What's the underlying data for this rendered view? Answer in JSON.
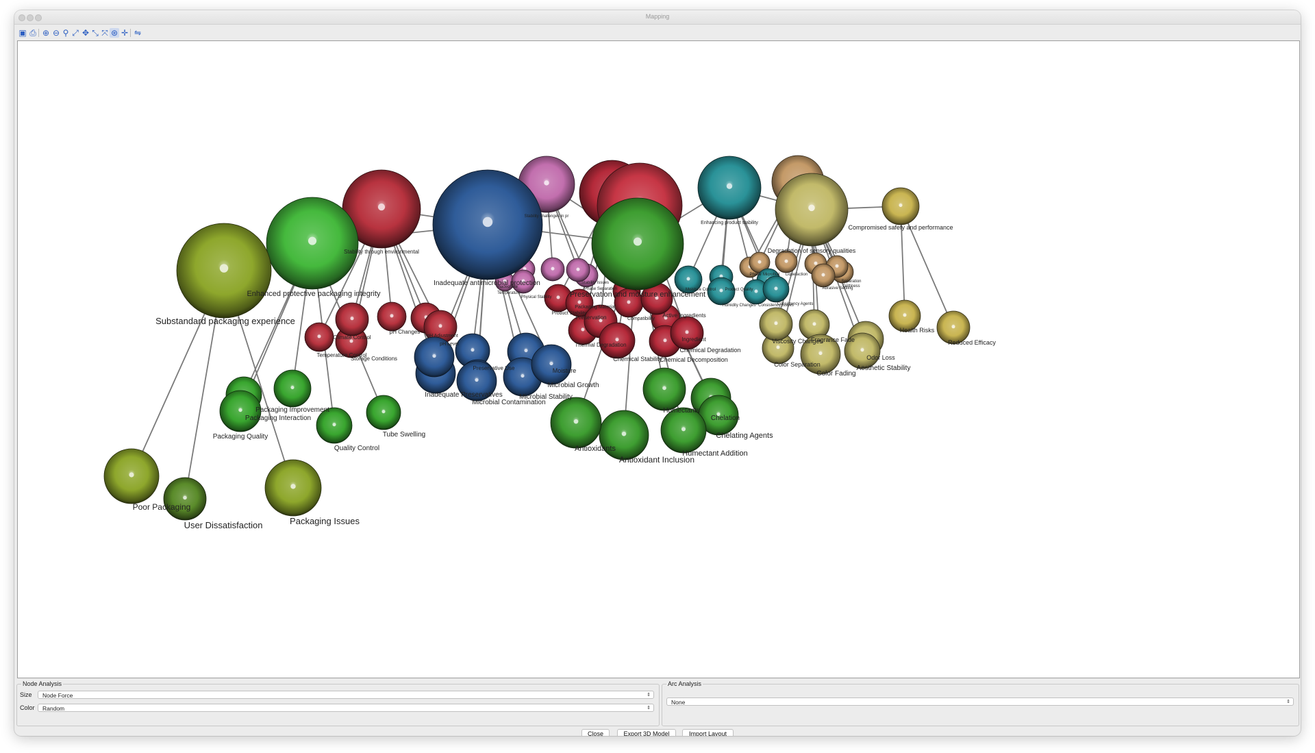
{
  "window": {
    "title": "Mapping"
  },
  "toolbar": {
    "buttons": [
      {
        "icon": "save-icon",
        "glyph": "▣",
        "active": false
      },
      {
        "icon": "print-icon",
        "glyph": "⎙",
        "active": false
      },
      {
        "icon": "zoom-in-icon",
        "glyph": "⊕",
        "active": false
      },
      {
        "icon": "zoom-out-icon",
        "glyph": "⊖",
        "active": false
      },
      {
        "icon": "zoom-search-icon",
        "glyph": "⚲",
        "active": false
      },
      {
        "icon": "fit-window-icon",
        "glyph": "⤢",
        "active": false
      },
      {
        "icon": "move-icon",
        "glyph": "✥",
        "active": false
      },
      {
        "icon": "expand-icon",
        "glyph": "⤡",
        "active": false
      },
      {
        "icon": "contract-icon",
        "glyph": "⤧",
        "active": false
      },
      {
        "icon": "rotate-icon",
        "glyph": "⊛",
        "active": true
      },
      {
        "icon": "pan-icon",
        "glyph": "✛",
        "active": false
      },
      {
        "icon": "layout-icon",
        "glyph": "⇋",
        "active": false
      }
    ]
  },
  "graph": {
    "nodes": [
      {
        "id": "n1",
        "label": "Substandard packaging experience",
        "color": "#8ea72c",
        "r": 69,
        "lx": "right",
        "fs": 13
      },
      {
        "id": "n2",
        "label": "Enhanced protective packaging integrity",
        "color": "#45b93d",
        "r": 67,
        "lx": "right",
        "fs": 11
      },
      {
        "id": "n3",
        "label": "Stability through environmental",
        "color": "#b8333f",
        "r": 57,
        "lx": "center",
        "fs": 8
      },
      {
        "id": "n4",
        "label": "Inadequate antimicrobial protection",
        "color": "#2f5c99",
        "r": 80,
        "lx": "center",
        "fs": 10
      },
      {
        "id": "n5",
        "label": "Stability challenges in pr",
        "color": "#c26fae",
        "r": 41,
        "lx": "center",
        "fs": 6
      },
      {
        "id": "n6",
        "label": "",
        "color": "#b52a3a",
        "r": 48,
        "lx": "center",
        "fs": 8
      },
      {
        "id": "n7",
        "label": "",
        "color": "#c63645",
        "r": 62,
        "lx": "center",
        "fs": 8
      },
      {
        "id": "n8",
        "label": "Preservation and moisture enhancement",
        "color": "#3e9e31",
        "r": 67,
        "lx": "center",
        "fs": 11
      },
      {
        "id": "n9",
        "label": "Enhancing product stability",
        "color": "#2a9298",
        "r": 46,
        "lx": "center",
        "fs": 7
      },
      {
        "id": "n10",
        "label": "",
        "color": "#c49a68",
        "r": 38,
        "lx": "center",
        "fs": 8
      },
      {
        "id": "n11",
        "label": "Degradation of sensory qualities",
        "color": "#c2ba6a",
        "r": 53,
        "lx": "right",
        "fs": 9
      },
      {
        "id": "n12",
        "label": "Compromised safety and performance",
        "color": "#c9b552",
        "r": 27,
        "lx": "right",
        "fs": 9
      },
      {
        "id": "p1",
        "label": "Packaging Interaction",
        "color": "#39a62f",
        "r": 26,
        "lx": "center",
        "fs": 10
      },
      {
        "id": "p2",
        "label": "Packaging Quality",
        "color": "#39a62f",
        "r": 30,
        "lx": "center",
        "fs": 10
      },
      {
        "id": "p3",
        "label": "Packaging Improvement",
        "color": "#39a62f",
        "r": 27,
        "lx": "center",
        "fs": 10
      },
      {
        "id": "p4",
        "label": "Quality Control",
        "color": "#39a62f",
        "r": 26,
        "lx": "center",
        "fs": 10
      },
      {
        "id": "p5",
        "label": "Tube Swelling",
        "color": "#39a62f",
        "r": 25,
        "lx": "center",
        "fs": 10
      },
      {
        "id": "q1",
        "label": "Poor Packaging",
        "color": "#8ea72c",
        "r": 40,
        "lx": "center",
        "fs": 12
      },
      {
        "id": "q2",
        "label": "User Dissatisfaction",
        "color": "#5a8b2a",
        "r": 31,
        "lx": "center",
        "fs": 13
      },
      {
        "id": "q3",
        "label": "Packaging Issues",
        "color": "#8ea72c",
        "r": 41,
        "lx": "center",
        "fs": 13
      },
      {
        "id": "r1",
        "label": "Temperature Control",
        "color": "#b8333f",
        "r": 21,
        "lx": "center",
        "fs": 8
      },
      {
        "id": "r2",
        "label": "Climate Control",
        "color": "#b8333f",
        "r": 24,
        "lx": "center",
        "fs": 8
      },
      {
        "id": "r3",
        "label": "Storage Conditions",
        "color": "#b8333f",
        "r": 23,
        "lx": "center",
        "fs": 8
      },
      {
        "id": "r4",
        "label": "pH Changes",
        "color": "#b8333f",
        "r": 21,
        "lx": "center",
        "fs": 8
      },
      {
        "id": "r5",
        "label": "",
        "color": "#b8333f",
        "r": 22,
        "lx": "center",
        "fs": 8
      },
      {
        "id": "r6",
        "label": "pH Adjustment",
        "color": "#b8333f",
        "r": 24,
        "lx": "center",
        "fs": 7
      },
      {
        "id": "r7",
        "label": "pH Level",
        "color": "#b8333f",
        "r": 23,
        "lx": "center",
        "fs": 7
      },
      {
        "id": "b1",
        "label": "Preservative Use",
        "color": "#2f5c99",
        "r": 25,
        "lx": "center",
        "fs": 8
      },
      {
        "id": "b2",
        "label": "Inadequate Preservatives",
        "color": "#2f5c99",
        "r": 29,
        "lx": "center",
        "fs": 10
      },
      {
        "id": "b3",
        "label": "Microbial Contamination",
        "color": "#2f5c99",
        "r": 29,
        "lx": "center",
        "fs": 10
      },
      {
        "id": "b4",
        "label": "Moisture",
        "color": "#2f5c99",
        "r": 27,
        "lx": "center",
        "fs": 9
      },
      {
        "id": "b5",
        "label": "Microbial Growth",
        "color": "#2f5c99",
        "r": 29,
        "lx": "center",
        "fs": 10
      },
      {
        "id": "b6",
        "label": "Microbial Stability",
        "color": "#2f5c99",
        "r": 28,
        "lx": "center",
        "fs": 10
      },
      {
        "id": "b7",
        "label": "",
        "color": "#2f5c99",
        "r": 25,
        "lx": "center",
        "fs": 8
      },
      {
        "id": "b8",
        "label": "",
        "color": "#2f5c99",
        "r": 29,
        "lx": "center",
        "fs": 8
      },
      {
        "id": "pk1",
        "label": "Physical Stability",
        "color": "#c26fae",
        "r": 17,
        "lx": "center",
        "fs": 6
      },
      {
        "id": "pk2",
        "label": "Temperature",
        "color": "#c26fae",
        "r": 17,
        "lx": "center",
        "fs": 6
      },
      {
        "id": "pk3",
        "label": "Phase Separation",
        "color": "#c26fae",
        "r": 17,
        "lx": "center",
        "fs": 6
      },
      {
        "id": "pk4",
        "label": "Stability Issues",
        "color": "#c26fae",
        "r": 17,
        "lx": "center",
        "fs": 6
      },
      {
        "id": "pk5",
        "label": "",
        "color": "#c26fae",
        "r": 15,
        "lx": "center",
        "fs": 6
      },
      {
        "id": "pk6",
        "label": "Inadequate",
        "color": "#c26fae",
        "r": 14,
        "lx": "center",
        "fs": 6
      },
      {
        "id": "rd1",
        "label": "Product Stability",
        "color": "#b52a3a",
        "r": 20,
        "lx": "center",
        "fs": 7
      },
      {
        "id": "rd2",
        "label": "Packaging Material",
        "color": "#b52a3a",
        "r": 20,
        "lx": "center",
        "fs": 7
      },
      {
        "id": "rd3",
        "label": "Preservation",
        "color": "#b52a3a",
        "r": 24,
        "lx": "center",
        "fs": 8
      },
      {
        "id": "rd4",
        "label": "Thermal Degradation",
        "color": "#b52a3a",
        "r": 21,
        "lx": "center",
        "fs": 8
      },
      {
        "id": "rd5",
        "label": "Chemical Stability",
        "color": "#b52a3a",
        "r": 26,
        "lx": "center",
        "fs": 9
      },
      {
        "id": "rd6",
        "label": "Compatibility",
        "color": "#b52a3a",
        "r": 21,
        "lx": "center",
        "fs": 7
      },
      {
        "id": "rd7",
        "label": "Active Ingredients",
        "color": "#b52a3a",
        "r": 23,
        "lx": "center",
        "fs": 8
      },
      {
        "id": "rd8",
        "label": "Chemical Degradation",
        "color": "#b52a3a",
        "r": 23,
        "lx": "center",
        "fs": 9
      },
      {
        "id": "rd9",
        "label": "Chemical Decomposition",
        "color": "#b52a3a",
        "r": 24,
        "lx": "center",
        "fs": 9
      },
      {
        "id": "rd10",
        "label": "Ingredient",
        "color": "#b52a3a",
        "r": 21,
        "lx": "center",
        "fs": 8
      },
      {
        "id": "rd11",
        "label": "",
        "color": "#b52a3a",
        "r": 20,
        "lx": "center",
        "fs": 8
      },
      {
        "id": "g1",
        "label": "Antioxidants",
        "color": "#3e9e31",
        "r": 37,
        "lx": "center",
        "fs": 11
      },
      {
        "id": "g2",
        "label": "Antioxidant Inclusion",
        "color": "#3e9e31",
        "r": 36,
        "lx": "center",
        "fs": 12
      },
      {
        "id": "g3",
        "label": "Humectants",
        "color": "#3e9e31",
        "r": 31,
        "lx": "center",
        "fs": 10
      },
      {
        "id": "g4",
        "label": "Humectant Addition",
        "color": "#3e9e31",
        "r": 33,
        "lx": "center",
        "fs": 11
      },
      {
        "id": "g5",
        "label": "Chelation",
        "color": "#3e9e31",
        "r": 29,
        "lx": "center",
        "fs": 10
      },
      {
        "id": "g6",
        "label": "Chelating Agents",
        "color": "#3e9e31",
        "r": 29,
        "lx": "center",
        "fs": 11
      },
      {
        "id": "t1",
        "label": "Moisture Control",
        "color": "#2a9298",
        "r": 20,
        "lx": "center",
        "fs": 6
      },
      {
        "id": "t2",
        "label": "Product Quality",
        "color": "#2a9298",
        "r": 17,
        "lx": "center",
        "fs": 6
      },
      {
        "id": "t3",
        "label": "Humidity Changes",
        "color": "#2a9298",
        "r": 20,
        "lx": "center",
        "fs": 6
      },
      {
        "id": "t4",
        "label": "Consistency Issues",
        "color": "#2a9298",
        "r": 18,
        "lx": "center",
        "fs": 6
      },
      {
        "id": "t5",
        "label": "",
        "color": "#2a9298",
        "r": 17,
        "lx": "center",
        "fs": 6
      },
      {
        "id": "t6",
        "label": "",
        "color": "#2a9298",
        "r": 19,
        "lx": "center",
        "fs": 6
      },
      {
        "id": "k1",
        "label": "Phase",
        "color": "#c49a68",
        "r": 15,
        "lx": "center",
        "fs": 6
      },
      {
        "id": "k2",
        "label": "Microbial",
        "color": "#c49a68",
        "r": 15,
        "lx": "center",
        "fs": 6
      },
      {
        "id": "k3",
        "label": "Liquefaction",
        "color": "#c49a68",
        "r": 16,
        "lx": "center",
        "fs": 6
      },
      {
        "id": "k4",
        "label": "Consistency Agents",
        "color": "#c49a68",
        "r": 16,
        "lx": "center",
        "fs": 6
      },
      {
        "id": "k5",
        "label": "Abrasive Settling",
        "color": "#c49a68",
        "r": 17,
        "lx": "center",
        "fs": 6
      },
      {
        "id": "k6",
        "label": "Grittiness",
        "color": "#c49a68",
        "r": 16,
        "lx": "center",
        "fs": 6
      },
      {
        "id": "k7",
        "label": "Separation",
        "color": "#c49a68",
        "r": 16,
        "lx": "center",
        "fs": 6
      },
      {
        "id": "y1",
        "label": "Viscosity Changes",
        "color": "#c2ba6a",
        "r": 24,
        "lx": "center",
        "fs": 9
      },
      {
        "id": "y2",
        "label": "Fragrance Fade",
        "color": "#c2ba6a",
        "r": 22,
        "lx": "center",
        "fs": 9
      },
      {
        "id": "y3",
        "label": "Color Separation",
        "color": "#c2ba6a",
        "r": 23,
        "lx": "center",
        "fs": 9
      },
      {
        "id": "y4",
        "label": "Color Fading",
        "color": "#c2ba6a",
        "r": 29,
        "lx": "center",
        "fs": 10
      },
      {
        "id": "y5",
        "label": "Odor Loss",
        "color": "#c2ba6a",
        "r": 26,
        "lx": "center",
        "fs": 9
      },
      {
        "id": "y6",
        "label": "Aesthetic Stability",
        "color": "#c2ba6a",
        "r": 26,
        "lx": "center",
        "fs": 10
      },
      {
        "id": "s1",
        "label": "Health Risks",
        "color": "#c9b552",
        "r": 23,
        "lx": "center",
        "fs": 9
      },
      {
        "id": "s2",
        "label": "Reduced Efficacy",
        "color": "#c9b552",
        "r": 24,
        "lx": "center",
        "fs": 9
      }
    ],
    "edges": [
      [
        "n1",
        "n2"
      ],
      [
        "n2",
        "n3"
      ],
      [
        "n2",
        "n4"
      ],
      [
        "n3",
        "n4"
      ],
      [
        "n4",
        "n5"
      ],
      [
        "n4",
        "n8"
      ],
      [
        "n5",
        "n8"
      ],
      [
        "n6",
        "n8"
      ],
      [
        "n7",
        "n8"
      ],
      [
        "n8",
        "n9"
      ],
      [
        "n9",
        "n11"
      ],
      [
        "n10",
        "n11"
      ],
      [
        "n11",
        "n12"
      ],
      [
        "n1",
        "q1"
      ],
      [
        "n1",
        "q2"
      ],
      [
        "n1",
        "q3"
      ],
      [
        "n2",
        "p1"
      ],
      [
        "n2",
        "p2"
      ],
      [
        "n2",
        "p3"
      ],
      [
        "n2",
        "p4"
      ],
      [
        "n2",
        "p5"
      ],
      [
        "n3",
        "r1"
      ],
      [
        "n3",
        "r2"
      ],
      [
        "n3",
        "r3"
      ],
      [
        "n3",
        "r4"
      ],
      [
        "n3",
        "r5"
      ],
      [
        "n3",
        "r6"
      ],
      [
        "n3",
        "r7"
      ],
      [
        "n4",
        "b1"
      ],
      [
        "n4",
        "b2"
      ],
      [
        "n4",
        "b3"
      ],
      [
        "n4",
        "b4"
      ],
      [
        "n4",
        "b5"
      ],
      [
        "n4",
        "b6"
      ],
      [
        "n4",
        "b7"
      ],
      [
        "n4",
        "b8"
      ],
      [
        "n5",
        "pk1"
      ],
      [
        "n5",
        "pk2"
      ],
      [
        "n5",
        "pk3"
      ],
      [
        "n5",
        "pk4"
      ],
      [
        "n5",
        "pk5"
      ],
      [
        "n5",
        "pk6"
      ],
      [
        "n6",
        "rd1"
      ],
      [
        "n6",
        "rd2"
      ],
      [
        "n6",
        "rd3"
      ],
      [
        "n6",
        "rd4"
      ],
      [
        "n7",
        "rd5"
      ],
      [
        "n7",
        "rd6"
      ],
      [
        "n7",
        "rd7"
      ],
      [
        "n7",
        "rd8"
      ],
      [
        "n7",
        "rd9"
      ],
      [
        "n7",
        "rd10"
      ],
      [
        "n7",
        "rd11"
      ],
      [
        "n8",
        "g1"
      ],
      [
        "n8",
        "g2"
      ],
      [
        "n8",
        "g3"
      ],
      [
        "n8",
        "g4"
      ],
      [
        "n8",
        "g5"
      ],
      [
        "n8",
        "g6"
      ],
      [
        "n9",
        "t1"
      ],
      [
        "n9",
        "t2"
      ],
      [
        "n9",
        "t3"
      ],
      [
        "n9",
        "t4"
      ],
      [
        "n9",
        "t5"
      ],
      [
        "n9",
        "t6"
      ],
      [
        "n10",
        "k1"
      ],
      [
        "n10",
        "k2"
      ],
      [
        "n10",
        "k3"
      ],
      [
        "n10",
        "k4"
      ],
      [
        "n10",
        "k5"
      ],
      [
        "n10",
        "k6"
      ],
      [
        "n10",
        "k7"
      ],
      [
        "n11",
        "y1"
      ],
      [
        "n11",
        "y2"
      ],
      [
        "n11",
        "y3"
      ],
      [
        "n11",
        "y4"
      ],
      [
        "n11",
        "y5"
      ],
      [
        "n11",
        "y6"
      ],
      [
        "n12",
        "s1"
      ],
      [
        "n12",
        "s2"
      ]
    ]
  },
  "node_analysis": {
    "title": "Node Analysis",
    "size_label": "Size",
    "size_value": "Node Force",
    "color_label": "Color",
    "color_value": "Random"
  },
  "arc_analysis": {
    "title": "Arc Analysis",
    "value": "None"
  },
  "buttons": {
    "close": "Close",
    "export": "Export 3D Model",
    "import": "Import Layout"
  }
}
